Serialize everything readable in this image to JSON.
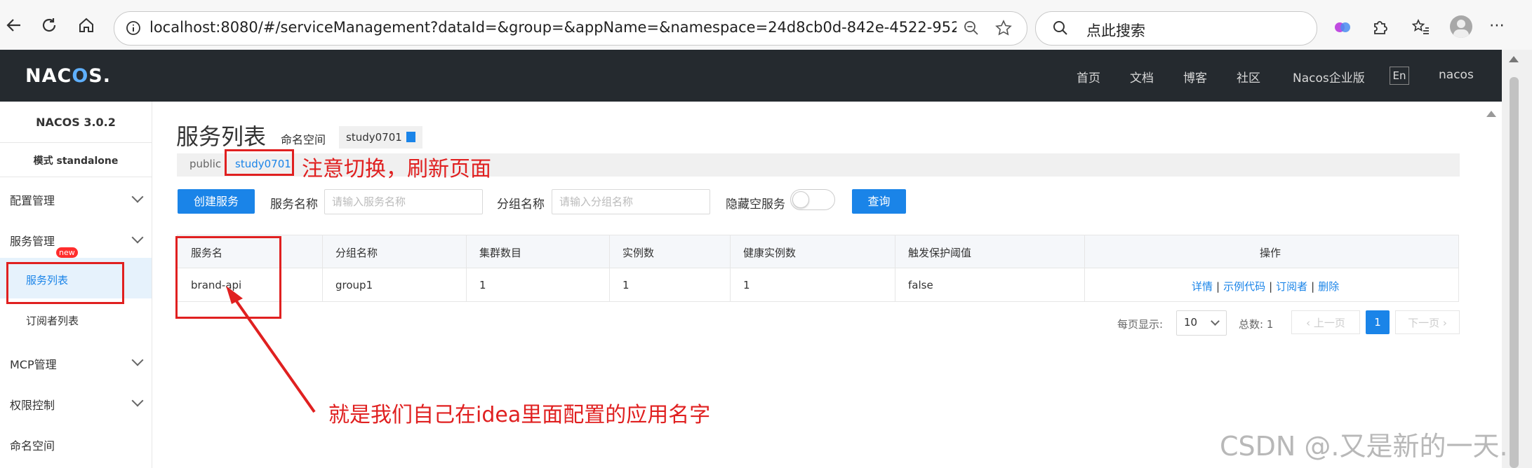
{
  "browser": {
    "url": "localhost:8080/#/serviceManagement?dataId=&group=&appName=&namespace=24d8cb0d-842e-4522-9529-d5bc69b3...",
    "search_placeholder": "点此搜索"
  },
  "header": {
    "logo_text_1": "NAC",
    "logo_text_2": "O",
    "logo_text_3": "S.",
    "nav": [
      "首页",
      "文档",
      "博客",
      "社区",
      "Nacos企业版"
    ],
    "lang": "En",
    "user": "nacos",
    "bg_color": "#252a2f"
  },
  "sidebar": {
    "version": "NACOS 3.0.2",
    "mode": "模式 standalone",
    "items": [
      {
        "label": "配置管理"
      },
      {
        "label": "服务管理"
      },
      {
        "label": "服务列表"
      },
      {
        "label": "订阅者列表"
      },
      {
        "label": "MCP管理"
      },
      {
        "label": "权限控制"
      },
      {
        "label": "命名空间"
      }
    ],
    "new_badge": "new"
  },
  "main": {
    "title": "服务列表",
    "namespace_label": "命名空间",
    "namespace_value": "study0701",
    "ns_tabs": [
      "public",
      "study0701"
    ],
    "create_button": "创建服务",
    "service_name_label": "服务名称",
    "service_name_placeholder": "请输入服务名称",
    "group_name_label": "分组名称",
    "group_name_placeholder": "请输入分组名称",
    "hide_empty_label": "隐藏空服务",
    "query_button": "查询",
    "accent_color": "#1a84e8"
  },
  "table": {
    "columns": [
      "服务名",
      "分组名称",
      "集群数目",
      "实例数",
      "健康实例数",
      "触发保护阈值",
      "操作"
    ],
    "rows": [
      {
        "name": "brand-api",
        "group": "group1",
        "clusters": "1",
        "instances": "1",
        "healthy": "1",
        "threshold": "false"
      }
    ],
    "ops": [
      "详情",
      "示例代码",
      "订阅者",
      "删除"
    ]
  },
  "pagination": {
    "per_page_label": "每页显示:",
    "per_page_value": "10",
    "total_label": "总数: 1",
    "prev": "上一页",
    "next": "下一页",
    "current": "1"
  },
  "annotations": {
    "switch_note": "注意切换，刷新页面",
    "app_note": "就是我们自己在idea里面配置的应用名字",
    "annotation_color": "#e02020"
  },
  "watermark": "CSDN @.又是新的一天."
}
